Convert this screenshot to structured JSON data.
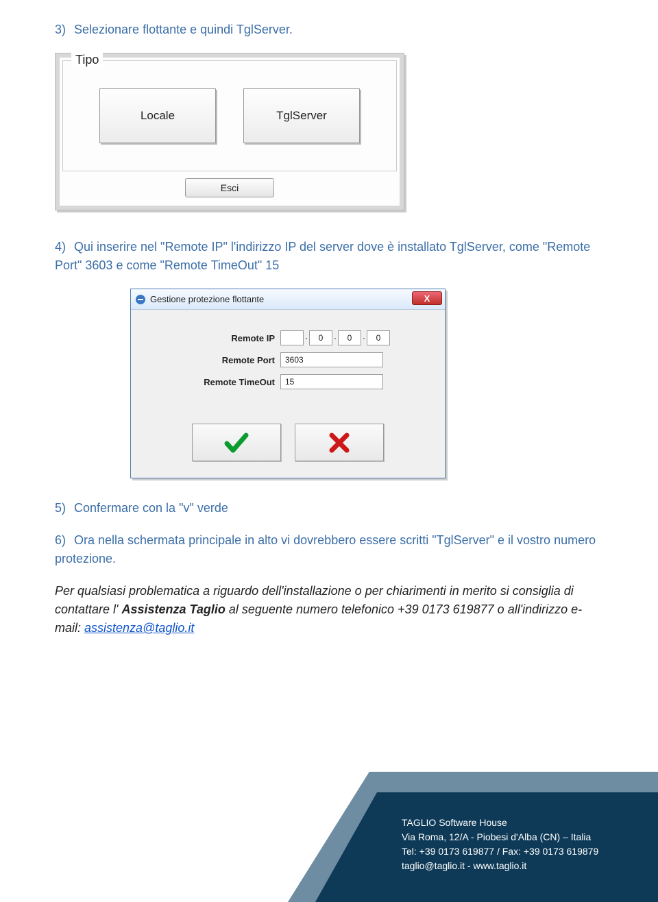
{
  "steps": {
    "s3": "Selezionare flottante e quindi TglServer.",
    "s4": "Qui inserire nel \"Remote IP\" l'indirizzo IP del server dove è installato TglServer, come \"Remote Port\" 3603 e come \"Remote TimeOut\" 15",
    "s5": "Confermare con la \"v\" verde",
    "s6": "Ora nella schermata principale in alto vi dovrebbero essere scritti \"TglServer\" e il vostro numero protezione."
  },
  "dialog1": {
    "legend": "Tipo",
    "btn_locale": "Locale",
    "btn_tglserver": "TglServer",
    "btn_esci": "Esci"
  },
  "dialog2": {
    "title": "Gestione protezione flottante",
    "close": "X",
    "labels": {
      "remote_ip": "Remote IP",
      "remote_port": "Remote Port",
      "remote_timeout": "Remote TimeOut"
    },
    "values": {
      "ip": [
        "",
        "0",
        "0",
        "0"
      ],
      "port": "3603",
      "timeout": "15"
    }
  },
  "note": {
    "part1": "Per qualsiasi problematica a riguardo dell'installazione o per chiarimenti in merito si consiglia di contattare l' ",
    "bold": "Assistenza Taglio",
    "part2": " al seguente numero telefonico +39 0173 619877  o all'indirizzo e-mail: ",
    "link": "assistenza@taglio.it"
  },
  "footer": {
    "line1": "TAGLIO Software House",
    "line2": "Via Roma, 12/A - Piobesi d'Alba (CN) – Italia",
    "line3": "Tel: +39 0173 619877 / Fax: +39 0173 619879",
    "line4": "taglio@taglio.it - www.taglio.it"
  }
}
